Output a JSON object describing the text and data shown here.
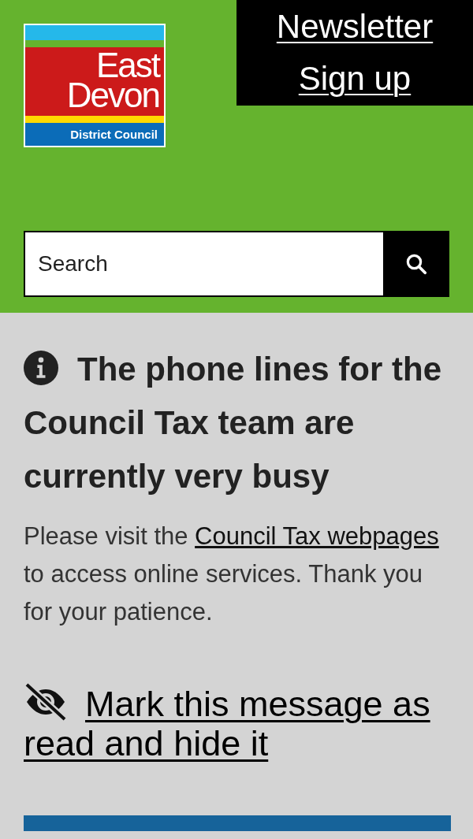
{
  "header": {
    "logo": {
      "line_1": "East",
      "line_2": "Devon",
      "subtitle": "District Council"
    },
    "newsletter_link": {
      "line_1": "Newsletter",
      "line_2": "Sign up"
    },
    "search": {
      "placeholder": "Search"
    }
  },
  "notice": {
    "heading": "The phone lines for the Council Tax team are currently very busy",
    "text_before": "Please visit the ",
    "link": "Council Tax webpages",
    "text_after": " to access online services. Thank you for your patience.",
    "hide_link": "Mark this message as read and hide it"
  }
}
